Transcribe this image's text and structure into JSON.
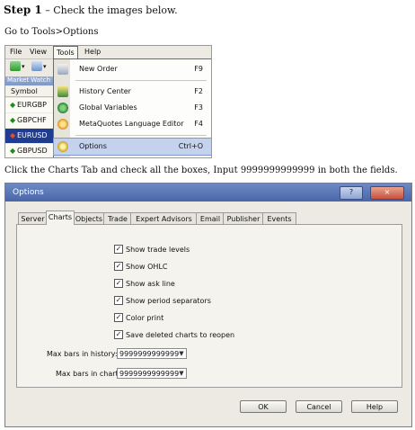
{
  "step_heading": "Step 1",
  "step_text": " – Check the images below.",
  "goto_text": "Go to Tools>Options",
  "click_text": "Click the Charts Tab and check all the boxes, Input 9999999999999 in both the fields.",
  "mt4": {
    "menus": [
      "File",
      "View",
      "Tools",
      "Help"
    ],
    "market_watch_header": "Market Watch",
    "symbol_header": "Symbol",
    "symbols": [
      "EURGBP",
      "GBPCHF",
      "EURUSD",
      "GBPUSD"
    ],
    "selected_symbol_index": 2,
    "dropdown": [
      {
        "label": "New Order",
        "key": "F9",
        "icon": "new-order-icon"
      },
      {
        "label": "History Center",
        "key": "F2",
        "icon": "history-center-icon"
      },
      {
        "label": "Global Variables",
        "key": "F3",
        "icon": "global-variables-icon"
      },
      {
        "label": "MetaQuotes Language Editor",
        "key": "F4",
        "icon": "metaeditor-icon"
      },
      {
        "label": "Options",
        "key": "Ctrl+O",
        "icon": "options-icon"
      }
    ]
  },
  "dialog": {
    "title": "Options",
    "tabs": [
      "Server",
      "Charts",
      "Objects",
      "Trade",
      "Expert Advisors",
      "Email",
      "Publisher",
      "Events"
    ],
    "active_tab": "Charts",
    "checkboxes": [
      {
        "label": "Show trade levels",
        "checked": true
      },
      {
        "label": "Show OHLC",
        "checked": true
      },
      {
        "label": "Show ask line",
        "checked": true
      },
      {
        "label": "Show period separators",
        "checked": true
      },
      {
        "label": "Color print",
        "checked": true
      },
      {
        "label": "Save deleted charts to reopen",
        "checked": true
      }
    ],
    "max_bars_history_label": "Max bars in history:",
    "max_bars_history_value": "9999999999999",
    "max_bars_chart_label": "Max bars in chart:",
    "max_bars_chart_value": "9999999999999",
    "ok_label": "OK",
    "cancel_label": "Cancel",
    "help_label": "Help",
    "title_buttons": [
      "?",
      "×"
    ]
  }
}
